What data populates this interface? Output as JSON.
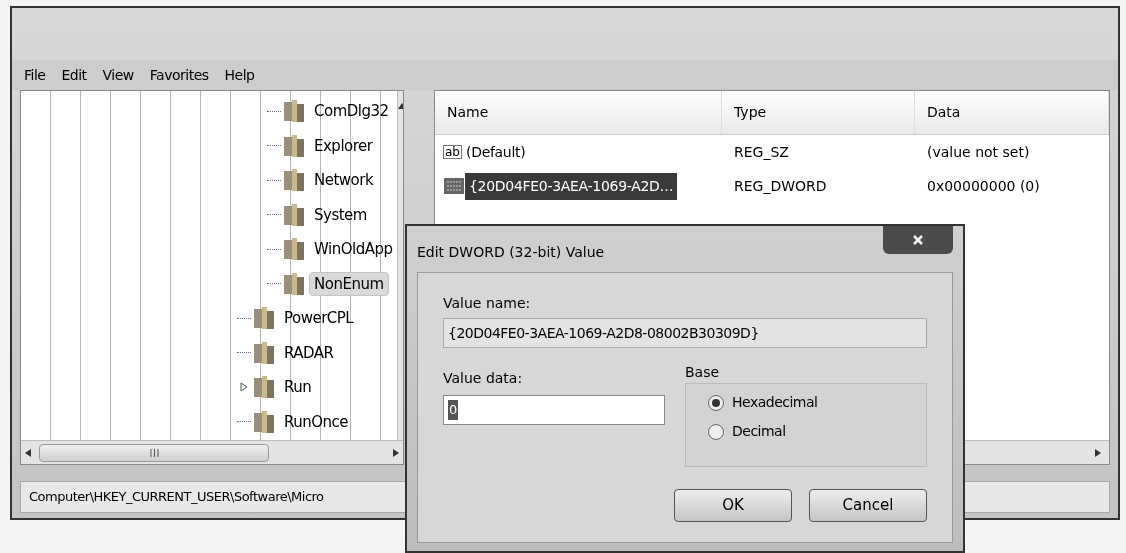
{
  "menu": [
    "File",
    "Edit",
    "View",
    "Favorites",
    "Help"
  ],
  "tree": {
    "items": [
      {
        "children": [
          {
            "label": "ComDlg32",
            "selected": false,
            "expandable": false
          },
          {
            "label": "Explorer",
            "selected": false,
            "expandable": false
          },
          {
            "label": "Network",
            "selected": false,
            "expandable": false
          },
          {
            "label": "System",
            "selected": false,
            "expandable": false
          },
          {
            "label": "WinOldApp",
            "selected": false,
            "expandable": false
          },
          {
            "label": "NonEnum",
            "selected": true,
            "expandable": false
          }
        ]
      },
      {
        "label": "PowerCPL",
        "selected": false,
        "expandable": false
      },
      {
        "label": "RADAR",
        "selected": false,
        "expandable": false
      },
      {
        "label": "Run",
        "selected": false,
        "expandable": true
      },
      {
        "label": "RunOnce",
        "selected": false,
        "expandable": false
      }
    ]
  },
  "values": {
    "columns": [
      "Name",
      "Type",
      "Data"
    ],
    "rows": [
      {
        "kind": "string",
        "icon": "ab",
        "name": "(Default)",
        "type": "REG_SZ",
        "data": "(value not set)",
        "selected": false
      },
      {
        "kind": "binary",
        "name": "{20D04FE0-3AEA-1069-A2D…",
        "type": "REG_DWORD",
        "data": "0x00000000 (0)",
        "selected": true
      }
    ]
  },
  "status_bar": "Computer\\HKEY_CURRENT_USER\\Software\\Micro",
  "dialog": {
    "title": "Edit DWORD (32-bit) Value",
    "value_name_label": "Value name:",
    "value_name": "{20D04FE0-3AEA-1069-A2D8-08002B30309D}",
    "value_data_label": "Value data:",
    "value_data": "0",
    "base_label": "Base",
    "radios": [
      {
        "label": "Hexadecimal",
        "selected": true
      },
      {
        "label": "Decimal",
        "selected": false
      }
    ],
    "buttons": [
      "OK",
      "Cancel"
    ]
  }
}
